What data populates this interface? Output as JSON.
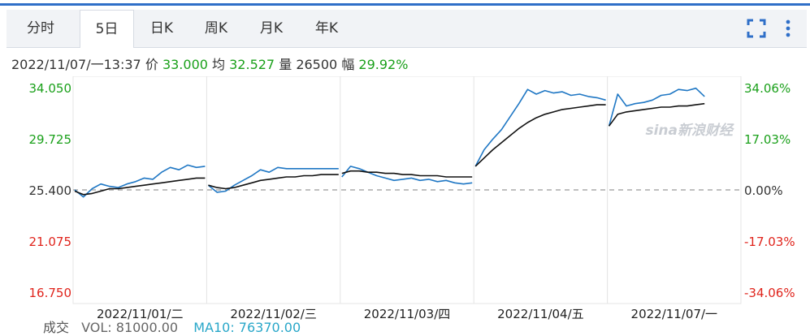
{
  "tabs": [
    {
      "label": "分时",
      "active": false
    },
    {
      "label": "5日",
      "active": true
    },
    {
      "label": "日K",
      "active": false
    },
    {
      "label": "周K",
      "active": false
    },
    {
      "label": "月K",
      "active": false
    },
    {
      "label": "年K",
      "active": false
    }
  ],
  "toolbar": {
    "fullscreen_icon": "fullscreen-icon",
    "menu_icon": "more-vertical-icon"
  },
  "info": {
    "datetime": "2022/11/07/一13:37",
    "price_label": "价",
    "price": "33.000",
    "avg_label": "均",
    "avg": "32.527",
    "volume_label": "量",
    "volume": "26500",
    "change_label": "幅",
    "change": "29.92%"
  },
  "watermark": {
    "text": "sina新浪财经"
  },
  "footer": {
    "label": "成交",
    "vol": "VOL: 81000.00",
    "ma": "MA10: 76370.00"
  },
  "colors": {
    "price_line": "#1f77c4",
    "avg_line": "#111111",
    "up": "#1aa01a",
    "down": "#e0241c",
    "baseline": "#999999"
  },
  "chart_data": {
    "type": "line",
    "title": "",
    "baseline_price": 25.4,
    "ylim": [
      16.75,
      34.05
    ],
    "y_ticks_left": [
      "34.050",
      "29.725",
      "25.400",
      "21.075",
      "16.750"
    ],
    "y_ticks_right": [
      "34.06%",
      "17.03%",
      "0.00%",
      "-17.03%",
      "-34.06%"
    ],
    "x_ticks": [
      "2022/11/01/二",
      "2022/11/02/三",
      "2022/11/03/四",
      "2022/11/04/五",
      "2022/11/07/一"
    ],
    "days": [
      {
        "date": "2022/11/01/二",
        "price": [
          25.4,
          24.8,
          25.5,
          25.9,
          25.7,
          25.6,
          25.9,
          26.1,
          26.4,
          26.3,
          26.9,
          27.3,
          27.1,
          27.5,
          27.3,
          27.4
        ],
        "avg": [
          25.3,
          25.0,
          25.1,
          25.3,
          25.5,
          25.5,
          25.6,
          25.7,
          25.8,
          25.9,
          26.0,
          26.1,
          26.2,
          26.3,
          26.4,
          26.4
        ]
      },
      {
        "date": "2022/11/02/三",
        "price": [
          25.8,
          25.2,
          25.3,
          25.8,
          26.2,
          26.6,
          27.1,
          26.9,
          27.3,
          27.2,
          27.2,
          27.2,
          27.2,
          27.2,
          27.2,
          27.2
        ],
        "avg": [
          25.8,
          25.6,
          25.5,
          25.6,
          25.8,
          26.0,
          26.2,
          26.3,
          26.4,
          26.5,
          26.5,
          26.6,
          26.6,
          26.7,
          26.7,
          26.7
        ]
      },
      {
        "date": "2022/11/03/四",
        "price": [
          26.5,
          27.4,
          27.2,
          26.9,
          26.6,
          26.4,
          26.2,
          26.3,
          26.4,
          26.2,
          26.3,
          26.1,
          26.2,
          26.0,
          25.9,
          26.0
        ],
        "avg": [
          26.8,
          27.0,
          27.0,
          26.9,
          26.9,
          26.8,
          26.8,
          26.7,
          26.7,
          26.6,
          26.6,
          26.6,
          26.5,
          26.5,
          26.5,
          26.5
        ]
      },
      {
        "date": "2022/11/04/五",
        "price": [
          27.4,
          28.8,
          29.7,
          30.5,
          31.6,
          32.7,
          33.9,
          33.5,
          33.8,
          33.6,
          33.7,
          33.4,
          33.5,
          33.3,
          33.2,
          33.0
        ],
        "avg": [
          27.4,
          28.1,
          28.8,
          29.4,
          30.0,
          30.6,
          31.1,
          31.5,
          31.8,
          32.0,
          32.2,
          32.3,
          32.4,
          32.5,
          32.6,
          32.6
        ]
      },
      {
        "date": "2022/11/07/一",
        "price": [
          30.8,
          33.5,
          32.5,
          32.7,
          32.8,
          33.0,
          33.4,
          33.5,
          33.9,
          33.8,
          34.0,
          33.3
        ],
        "avg": [
          30.8,
          31.8,
          32.0,
          32.1,
          32.2,
          32.3,
          32.4,
          32.4,
          32.5,
          32.5,
          32.6,
          32.7
        ]
      }
    ]
  }
}
